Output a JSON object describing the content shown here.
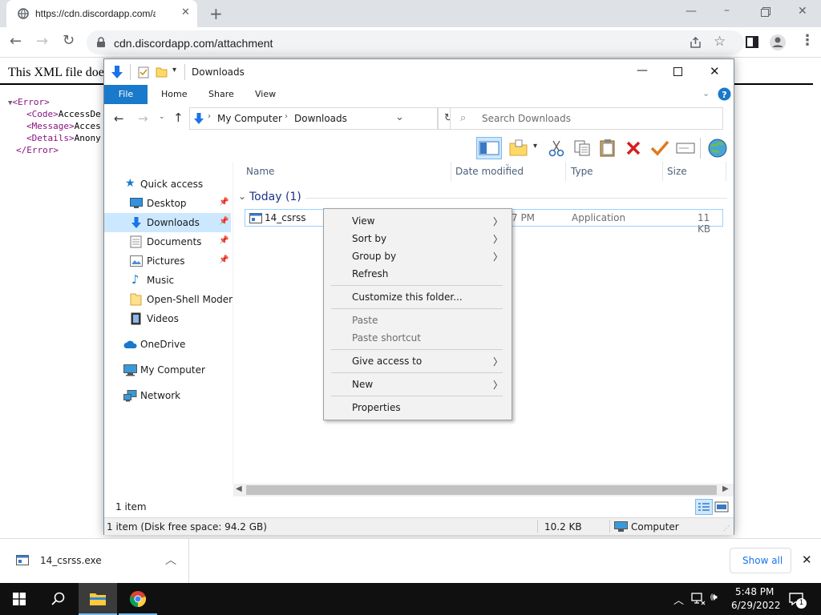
{
  "browser": {
    "tab_title": "https://cdn.discordapp.com/attac",
    "url": "cdn.discordapp.com/attachment",
    "new_tab": "+"
  },
  "xml_page": {
    "message": "This XML file doe",
    "lines": [
      {
        "prefix": "▼",
        "tag": "<Error>",
        "text": ""
      },
      {
        "prefix": "",
        "tag": "<Code>",
        "text": "AccessDe"
      },
      {
        "prefix": "",
        "tag": "<Message>",
        "text": "Acces"
      },
      {
        "prefix": "",
        "tag": "<Details>",
        "text": "Anony"
      },
      {
        "prefix": "",
        "tag": "</Error>",
        "text": ""
      }
    ]
  },
  "explorer": {
    "window_title": "Downloads",
    "ribbon_tabs": [
      "File",
      "Home",
      "Share",
      "View"
    ],
    "breadcrumb": [
      "My Computer",
      "Downloads"
    ],
    "search_placeholder": "Search Downloads",
    "nav": {
      "quick_access": "Quick access",
      "items": [
        "Desktop",
        "Downloads",
        "Documents",
        "Pictures",
        "Music",
        "Open-Shell Modern",
        "Videos"
      ],
      "onedrive": "OneDrive",
      "my_computer": "My Computer",
      "network": "Network"
    },
    "columns": [
      "Name",
      "Date modified",
      "Type",
      "Size"
    ],
    "group_header": "Today (1)",
    "file": {
      "name": "14_csrss",
      "date": "7 PM",
      "type": "Application",
      "size": "11 KB"
    },
    "item_count": "1 item",
    "status": {
      "left": "1 item (Disk free space: 94.2 GB)",
      "size": "10.2 KB",
      "location": "Computer"
    }
  },
  "context_menu": {
    "view": "View",
    "sort_by": "Sort by",
    "group_by": "Group by",
    "refresh": "Refresh",
    "customize": "Customize this folder...",
    "paste": "Paste",
    "paste_shortcut": "Paste shortcut",
    "give_access": "Give access to",
    "new": "New",
    "properties": "Properties"
  },
  "download_shelf": {
    "file": "14_csrss.exe",
    "show_all": "Show all"
  },
  "taskbar": {
    "time": "5:48 PM",
    "date": "6/29/2022",
    "notif_count": "1"
  }
}
